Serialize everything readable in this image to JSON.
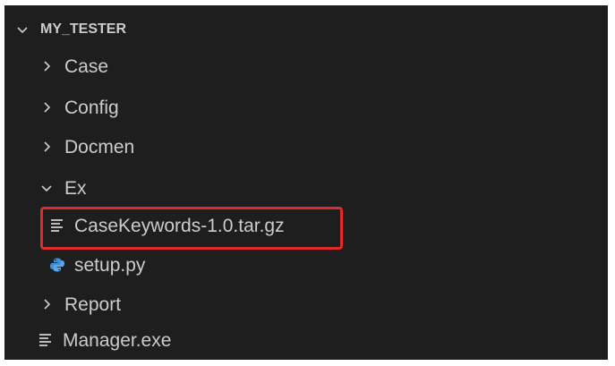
{
  "explorer": {
    "root": {
      "label": "MY_TESTER",
      "icon": "chevron-down-icon"
    },
    "items": [
      {
        "label": "Case",
        "icon": "chevron-right-icon"
      },
      {
        "label": "Config",
        "icon": "chevron-right-icon"
      },
      {
        "label": "Docmen",
        "icon": "chevron-right-icon"
      },
      {
        "label": "Ex",
        "icon": "chevron-down-icon"
      },
      {
        "label": "CaseKeywords-1.0.tar.gz",
        "icon": "text-file-icon",
        "highlighted": true
      },
      {
        "label": "setup.py",
        "icon": "python-file-icon"
      },
      {
        "label": "Report",
        "icon": "chevron-right-icon"
      },
      {
        "label": "Manager.exe",
        "icon": "text-file-icon"
      }
    ]
  },
  "colors": {
    "background": "#1e1e1e",
    "text": "#cccccc",
    "highlight_border": "#e02b2b",
    "python_icon": "#3b8fd9"
  }
}
